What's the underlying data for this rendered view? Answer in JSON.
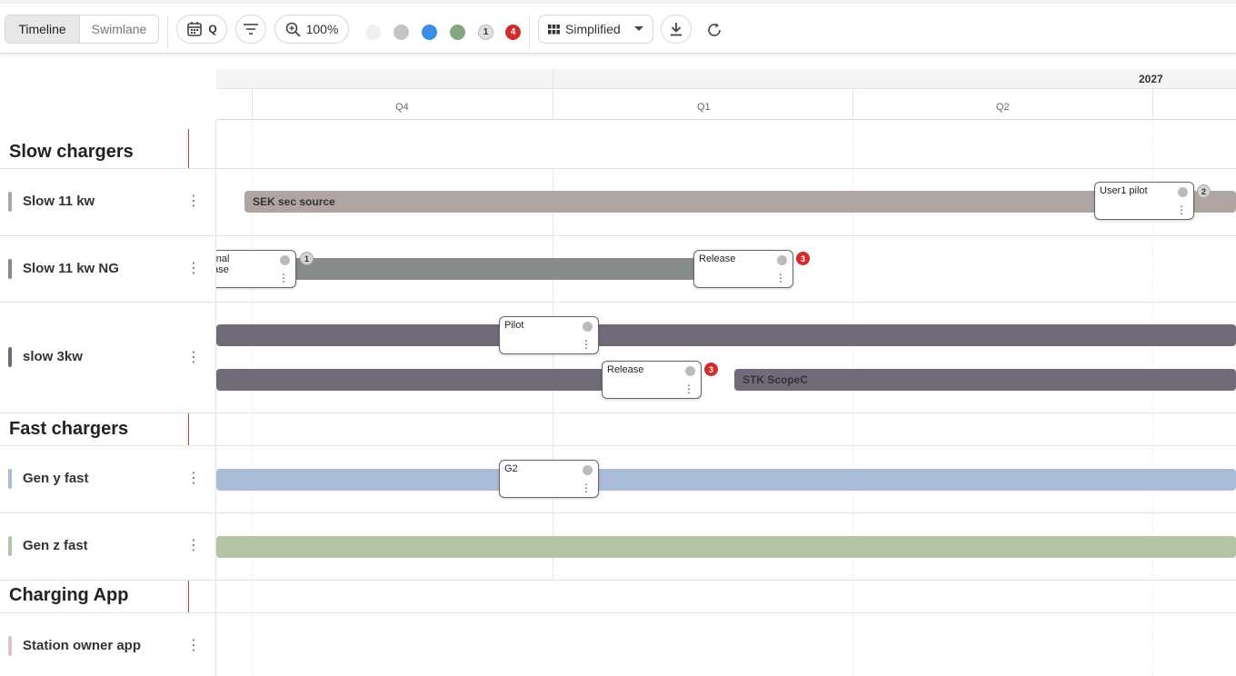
{
  "toolbar": {
    "view_tabs": [
      "Timeline",
      "Swimlane"
    ],
    "granularity": "Q",
    "zoom": "100%",
    "badge_grey": "1",
    "badge_red": "4",
    "layout": "Simplified",
    "status_colors": [
      "#f0f0f0",
      "#c4c4c4",
      "#3b8fe0",
      "#85a67e"
    ]
  },
  "timeline": {
    "year": "2027",
    "quarters": [
      "Q4",
      "Q1",
      "Q2"
    ]
  },
  "groups": [
    {
      "title": "Slow chargers"
    },
    {
      "title": "Fast chargers"
    },
    {
      "title": "Charging App"
    }
  ],
  "rows": [
    {
      "label": "Slow 11 kw",
      "color": "#b0a5a3"
    },
    {
      "label": "Slow 11 kw NG",
      "color": "#858c89"
    },
    {
      "label": "slow 3kw",
      "color": "#716a78"
    },
    {
      "label": "Gen y fast",
      "color": "#a8bcd8"
    },
    {
      "label": "Gen z fast",
      "color": "#b4c4a6"
    },
    {
      "label": "Station owner app",
      "color": "#dcc3cb"
    }
  ],
  "bars": {
    "sek": "SEK sec source",
    "stk": "STK ScopeC"
  },
  "milestones": {
    "user1": {
      "title": "User1 pilot",
      "badge": "2"
    },
    "internal": {
      "title": "ernal\nease",
      "badge": "1"
    },
    "release1": {
      "title": "Release",
      "badge": "3"
    },
    "pilot": {
      "title": "Pilot"
    },
    "release2": {
      "title": "Release",
      "badge": "3"
    },
    "g2": {
      "title": "G2"
    }
  }
}
